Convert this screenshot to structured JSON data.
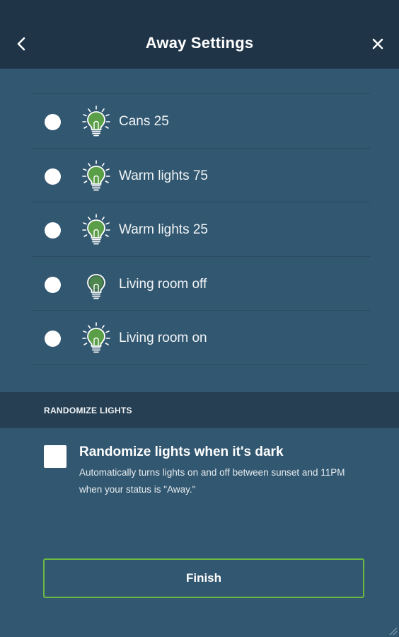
{
  "header": {
    "title": "Away Settings",
    "back_icon": "chevron-left-icon",
    "close_icon": "close-icon"
  },
  "scenes": [
    {
      "label": "Cans 25",
      "selected": false,
      "icon": "bulb-on-icon"
    },
    {
      "label": "Warm lights 75",
      "selected": false,
      "icon": "bulb-on-icon"
    },
    {
      "label": "Warm lights 25",
      "selected": false,
      "icon": "bulb-on-icon"
    },
    {
      "label": "Living room off",
      "selected": false,
      "icon": "bulb-off-icon"
    },
    {
      "label": "Living room on",
      "selected": false,
      "icon": "bulb-on-icon"
    }
  ],
  "randomize": {
    "section_title": "RANDOMIZE LIGHTS",
    "title": "Randomize lights when it's dark",
    "description": "Automatically turns lights on and off between sunset and 11PM when your status is \"Away.\"",
    "checked": false
  },
  "footer": {
    "finish_label": "Finish"
  },
  "colors": {
    "background": "#325770",
    "header": "#1f3447",
    "section": "#263f53",
    "accent": "#6cb843",
    "bulb_green": "#5a9e48"
  }
}
